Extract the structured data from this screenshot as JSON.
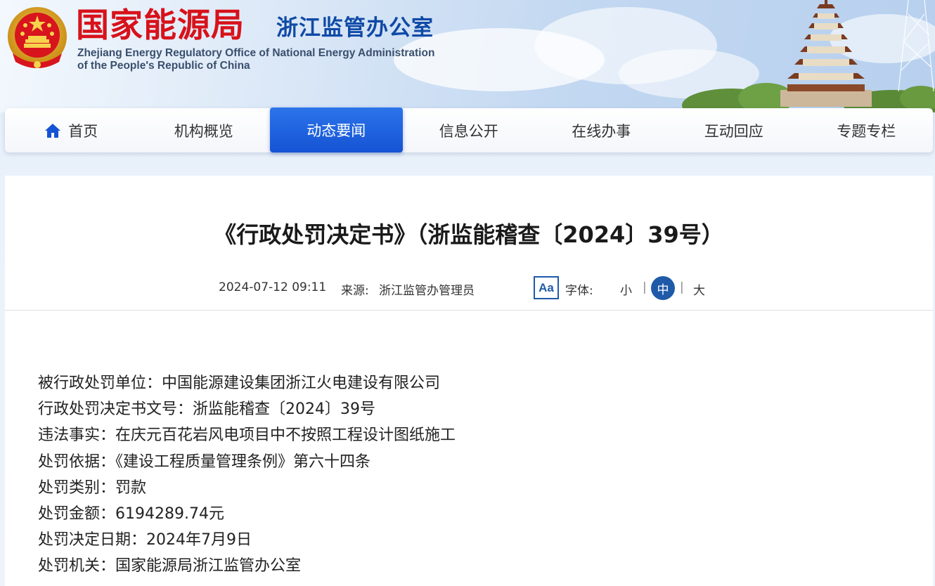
{
  "header": {
    "org_name": "国家能源局",
    "office_name": "浙江监管办公室",
    "org_name_en_line1": "Zhejiang Energy Regulatory Office of National Energy Administration",
    "org_name_en_line2": "of the People's Republic of China"
  },
  "nav": {
    "items": [
      {
        "label": "首页",
        "icon": "home-icon"
      },
      {
        "label": "机构概览"
      },
      {
        "label": "动态要闻",
        "active": true
      },
      {
        "label": "信息公开"
      },
      {
        "label": "在线办事"
      },
      {
        "label": "互动回应"
      },
      {
        "label": "专题专栏"
      }
    ]
  },
  "article": {
    "title": "《行政处罚决定书》（浙监能稽查〔2024〕39号）",
    "date": "2024-07-12 09:11",
    "source_label": "来源:",
    "source_value": "浙江监管办管理员",
    "font_icon": "Aa",
    "font_label": "字体:",
    "font_sizes": {
      "small": "小",
      "medium": "中",
      "large": "大",
      "selected": "中"
    },
    "separator": "|",
    "lines": [
      "被行政处罚单位：中国能源建设集团浙江火电建设有限公司",
      "行政处罚决定书文号：浙监能稽查〔2024〕39号",
      "违法事实：在庆元百花岩风电项目中不按照工程设计图纸施工",
      "处罚依据：《建设工程质量管理条例》第六十四条",
      "处罚类别：罚款",
      "处罚金额：6194289.74元",
      "处罚决定日期：2024年7月9日",
      "处罚机关：国家能源局浙江监管办公室"
    ]
  },
  "colors": {
    "brand_red": "#d7121b",
    "brand_blue": "#0f4aa6",
    "nav_active": "#1553d4",
    "accent": "#1f5aa8"
  }
}
